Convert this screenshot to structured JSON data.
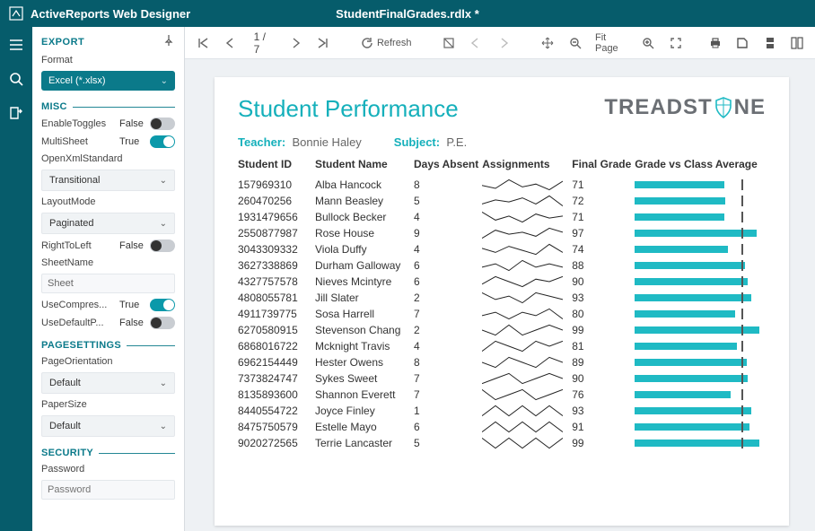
{
  "titlebar": {
    "app_name": "ActiveReports Web Designer",
    "file_name": "StudentFinalGrades.rdlx *"
  },
  "export_panel": {
    "title": "EXPORT",
    "format_label": "Format",
    "format_value": "Excel (*.xlsx)",
    "sections": {
      "misc": "MISC",
      "pagesettings": "PAGESETTINGS",
      "security": "SECURITY"
    },
    "misc": {
      "enable_toggles": {
        "label": "EnableToggles",
        "value": "False"
      },
      "multisheet": {
        "label": "MultiSheet",
        "value": "True"
      },
      "openxml_label": "OpenXmlStandard",
      "openxml_value": "Transitional",
      "layoutmode_label": "LayoutMode",
      "layoutmode_value": "Paginated",
      "righttoleft": {
        "label": "RightToLeft",
        "value": "False"
      },
      "sheetname_label": "SheetName",
      "sheetname_value": "Sheet",
      "usecompress": {
        "label": "UseCompres...",
        "value": "True"
      },
      "usedefault": {
        "label": "UseDefaultP...",
        "value": "False"
      }
    },
    "pagesettings": {
      "pageorientation_label": "PageOrientation",
      "pageorientation_value": "Default",
      "papersize_label": "PaperSize",
      "papersize_value": "Default"
    },
    "security": {
      "password_label": "Password",
      "password_placeholder": "Password"
    }
  },
  "toolbar": {
    "page_indicator": "1 / 7",
    "refresh_label": "Refresh",
    "fit_label": "Fit Page"
  },
  "report": {
    "title": "Student Performance",
    "brand": "TREADSTONE",
    "teacher_label": "Teacher:",
    "teacher_value": "Bonnie Haley",
    "subject_label": "Subject:",
    "subject_value": "P.E.",
    "columns": {
      "id": "Student ID",
      "name": "Student Name",
      "days": "Days Absent",
      "assign": "Assignments",
      "grade": "Final Grade",
      "bar": "Grade vs Class Average"
    },
    "class_average": 85,
    "rows": [
      {
        "id": "157969310",
        "name": "Alba Hancock",
        "days": "8",
        "grade": "71",
        "spark": [
          5,
          3,
          9,
          4,
          6,
          2,
          8
        ],
        "bar": 71,
        "avg": 85
      },
      {
        "id": "260470256",
        "name": "Mann Beasley",
        "days": "5",
        "grade": "72",
        "spark": [
          4,
          6,
          5,
          7,
          4,
          8,
          3
        ],
        "bar": 72,
        "avg": 85
      },
      {
        "id": "1931479656",
        "name": "Bullock Becker",
        "days": "4",
        "grade": "71",
        "spark": [
          8,
          4,
          6,
          3,
          7,
          5,
          6
        ],
        "bar": 71,
        "avg": 85
      },
      {
        "id": "2550877987",
        "name": "Rose House",
        "days": "9",
        "grade": "97",
        "spark": [
          3,
          7,
          5,
          6,
          4,
          8,
          6
        ],
        "bar": 97,
        "avg": 85
      },
      {
        "id": "3043309332",
        "name": "Viola Duffy",
        "days": "4",
        "grade": "74",
        "spark": [
          6,
          4,
          7,
          5,
          3,
          8,
          4
        ],
        "bar": 74,
        "avg": 85
      },
      {
        "id": "3627338869",
        "name": "Durham Galloway",
        "days": "6",
        "grade": "88",
        "spark": [
          5,
          6,
          4,
          7,
          5,
          6,
          5
        ],
        "bar": 88,
        "avg": 85
      },
      {
        "id": "4327757578",
        "name": "Nieves Mcintyre",
        "days": "6",
        "grade": "90",
        "spark": [
          4,
          7,
          5,
          3,
          6,
          5,
          7
        ],
        "bar": 90,
        "avg": 85
      },
      {
        "id": "4808055781",
        "name": "Jill Slater",
        "days": "2",
        "grade": "93",
        "spark": [
          7,
          5,
          6,
          4,
          7,
          6,
          5
        ],
        "bar": 93,
        "avg": 85
      },
      {
        "id": "4911739775",
        "name": "Sosa Harrell",
        "days": "7",
        "grade": "80",
        "spark": [
          5,
          6,
          4,
          6,
          5,
          7,
          4
        ],
        "bar": 80,
        "avg": 85
      },
      {
        "id": "6270580915",
        "name": "Stevenson Chang",
        "days": "2",
        "grade": "99",
        "spark": [
          6,
          5,
          7,
          5,
          6,
          7,
          6
        ],
        "bar": 99,
        "avg": 85
      },
      {
        "id": "6868016722",
        "name": "Mcknight Travis",
        "days": "4",
        "grade": "81",
        "spark": [
          4,
          6,
          5,
          4,
          6,
          5,
          6
        ],
        "bar": 81,
        "avg": 85
      },
      {
        "id": "6962154449",
        "name": "Hester Owens",
        "days": "8",
        "grade": "89",
        "spark": [
          5,
          4,
          6,
          5,
          4,
          6,
          5
        ],
        "bar": 89,
        "avg": 85
      },
      {
        "id": "7373824747",
        "name": "Sykes Sweet",
        "days": "7",
        "grade": "90",
        "spark": [
          4,
          5,
          6,
          4,
          5,
          6,
          5
        ],
        "bar": 90,
        "avg": 85
      },
      {
        "id": "8135893600",
        "name": "Shannon Everett",
        "days": "7",
        "grade": "76",
        "spark": [
          6,
          4,
          5,
          6,
          4,
          5,
          6
        ],
        "bar": 76,
        "avg": 85
      },
      {
        "id": "8440554722",
        "name": "Joyce Finley",
        "days": "1",
        "grade": "93",
        "spark": [
          5,
          6,
          5,
          6,
          5,
          6,
          5
        ],
        "bar": 93,
        "avg": 85
      },
      {
        "id": "8475750579",
        "name": "Estelle Mayo",
        "days": "6",
        "grade": "91",
        "spark": [
          4,
          5,
          4,
          5,
          4,
          5,
          4
        ],
        "bar": 91,
        "avg": 85
      },
      {
        "id": "9020272565",
        "name": "Terrie Lancaster",
        "days": "5",
        "grade": "99",
        "spark": [
          5,
          4,
          5,
          4,
          5,
          4,
          5
        ],
        "bar": 99,
        "avg": 85
      }
    ]
  },
  "chart_data": {
    "type": "bar",
    "title": "Grade vs Class Average",
    "xlabel": "",
    "ylabel": "Final Grade",
    "ylim": [
      0,
      100
    ],
    "categories": [
      "Alba Hancock",
      "Mann Beasley",
      "Bullock Becker",
      "Rose House",
      "Viola Duffy",
      "Durham Galloway",
      "Nieves Mcintyre",
      "Jill Slater",
      "Sosa Harrell",
      "Stevenson Chang",
      "Mcknight Travis",
      "Hester Owens",
      "Sykes Sweet",
      "Shannon Everett",
      "Joyce Finley",
      "Estelle Mayo",
      "Terrie Lancaster"
    ],
    "values": [
      71,
      72,
      71,
      97,
      74,
      88,
      90,
      93,
      80,
      99,
      81,
      89,
      90,
      76,
      93,
      91,
      99
    ],
    "reference_line": {
      "name": "Class Average",
      "value": 85
    }
  }
}
